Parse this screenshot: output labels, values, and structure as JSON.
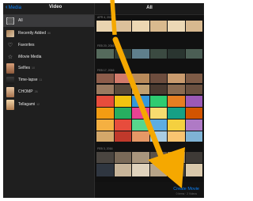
{
  "header": {
    "back_label": "Media",
    "sidebar_title": "Video",
    "grid_title": "All"
  },
  "sidebar": {
    "items": [
      {
        "label": "All",
        "count": "",
        "icon": "film-icon",
        "selected": true
      },
      {
        "label": "Recently Added",
        "count": "86",
        "icon": "thumbnail"
      },
      {
        "label": "Favorites",
        "count": "",
        "icon": "heart-icon"
      },
      {
        "label": "iMovie Media",
        "count": "",
        "icon": "star-icon"
      },
      {
        "label": "Selfies",
        "count": "10",
        "icon": "thumbnail"
      },
      {
        "label": "Time-lapse",
        "count": "11",
        "icon": "thumbnail"
      },
      {
        "label": "CHOMP",
        "count": "26",
        "icon": "thumbnail"
      },
      {
        "label": "Tellagami",
        "count": "12",
        "icon": "thumbnail"
      }
    ]
  },
  "grid": {
    "sections": [
      "APR 4, 2016",
      "FEB 20, 2016",
      "FEB 17, 2016",
      "FEB 3, 2016"
    ]
  },
  "footer": {
    "create_label": "Create Movie",
    "create_sub": "0 items · 2 Videos"
  },
  "colors": {
    "accent": "#0a84ff",
    "arrow": "#f5a800",
    "sidebar_bg": "#1f1f1f",
    "selected_bg": "#3a3a3c"
  }
}
